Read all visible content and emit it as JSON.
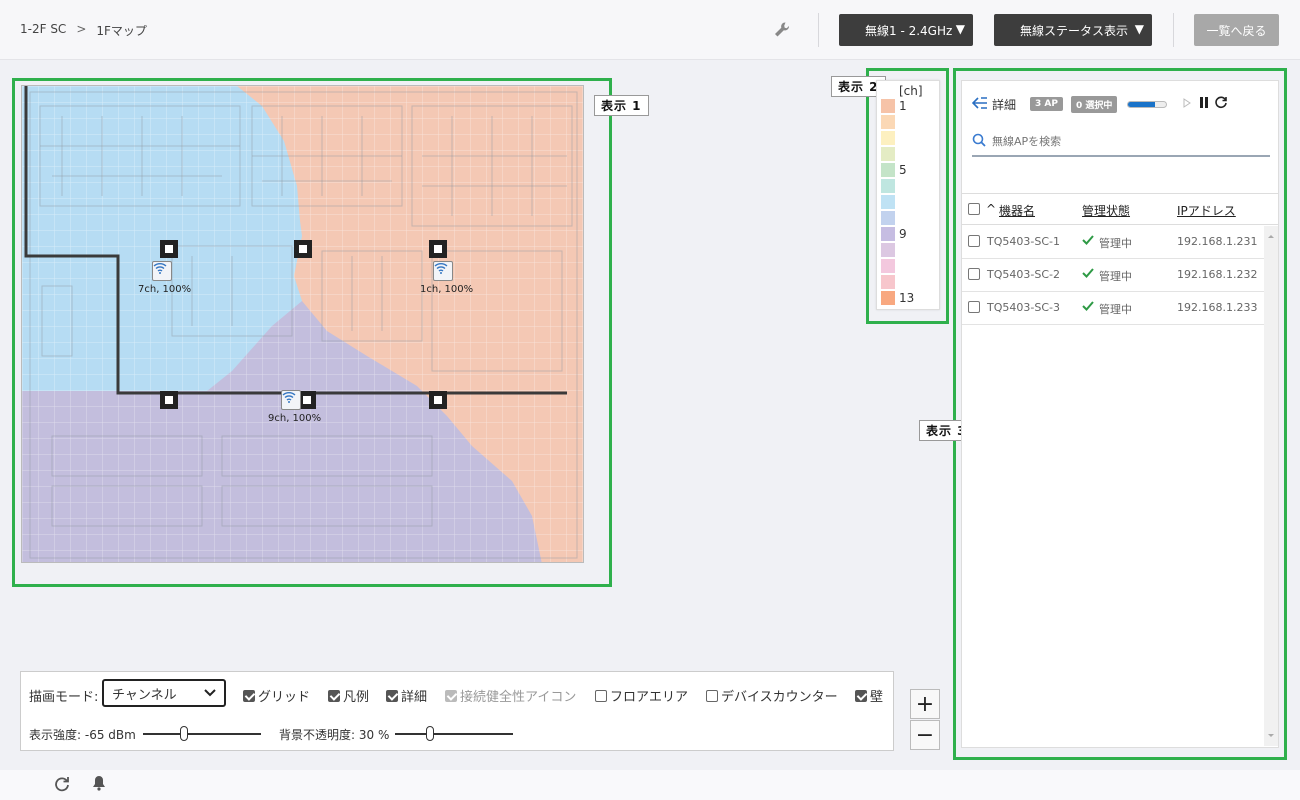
{
  "breadcrumb": {
    "root": "1-2F SC",
    "separator": ">",
    "current": "1Fマップ"
  },
  "header": {
    "band_select": "無線1 - 2.4GHz",
    "status_select": "無線ステータス表示",
    "back_button": "一覧へ戻る",
    "dropdown_arrow": "▼"
  },
  "tags": {
    "area1": "表示 1",
    "area2": "表示 2",
    "area3": "表示 3"
  },
  "map": {
    "access_points": [
      {
        "label": "7ch, 100%",
        "icon": "wifi-icon"
      },
      {
        "label": "1ch, 100%",
        "icon": "wifi-icon"
      },
      {
        "label": "9ch, 100%",
        "icon": "wifi-icon"
      }
    ]
  },
  "legend": {
    "unit": "[ch]",
    "labels": {
      "ch1": "1",
      "ch5": "5",
      "ch9": "9",
      "ch13": "13"
    },
    "colors": [
      "#f6c3a8",
      "#fbd8b5",
      "#fdf0c0",
      "#e4ecc4",
      "#c4e4c8",
      "#bfe6e0",
      "#bfe2f4",
      "#c2d2ee",
      "#c6bde2",
      "#dcc8e2",
      "#f3c8de",
      "#f7c6cc",
      "#f8a880"
    ]
  },
  "panel": {
    "details_label": "詳細",
    "ap_badge": "3 AP",
    "selected_badge": "0 選択中",
    "progress": 0.7,
    "search_placeholder": "無線APを検索",
    "columns": {
      "name": "機器名",
      "status": "管理状態",
      "ip": "IPアドレス"
    },
    "sort_indicator": "^",
    "rows": [
      {
        "name": "TQ5403-SC-1",
        "status": "管理中",
        "ip": "192.168.1.231"
      },
      {
        "name": "TQ5403-SC-2",
        "status": "管理中",
        "ip": "192.168.1.232"
      },
      {
        "name": "TQ5403-SC-3",
        "status": "管理中",
        "ip": "192.168.1.233"
      }
    ]
  },
  "controls": {
    "mode_label": "描画モード:",
    "mode_value": "チャンネル",
    "options": [
      {
        "label": "グリッド",
        "state": "checked"
      },
      {
        "label": "凡例",
        "state": "checked"
      },
      {
        "label": "詳細",
        "state": "checked"
      },
      {
        "label": "接続健全性アイコン",
        "state": "disabled"
      },
      {
        "label": "フロアエリア",
        "state": "unchecked"
      },
      {
        "label": "デバイスカウンター",
        "state": "unchecked"
      },
      {
        "label": "壁",
        "state": "checked"
      }
    ],
    "strength_label": "表示強度: -65 dBm",
    "strength_level": 0.35,
    "opacity_label": "背景不透明度: 30 %",
    "opacity_level": 0.3
  },
  "zoom": {
    "in": "+",
    "out": "−"
  },
  "colors": {
    "accent_green": "#2fb04c",
    "coverage_blue": "#b6dcf3",
    "coverage_orange": "#f4c8b4",
    "coverage_purple": "#c3bedd"
  }
}
